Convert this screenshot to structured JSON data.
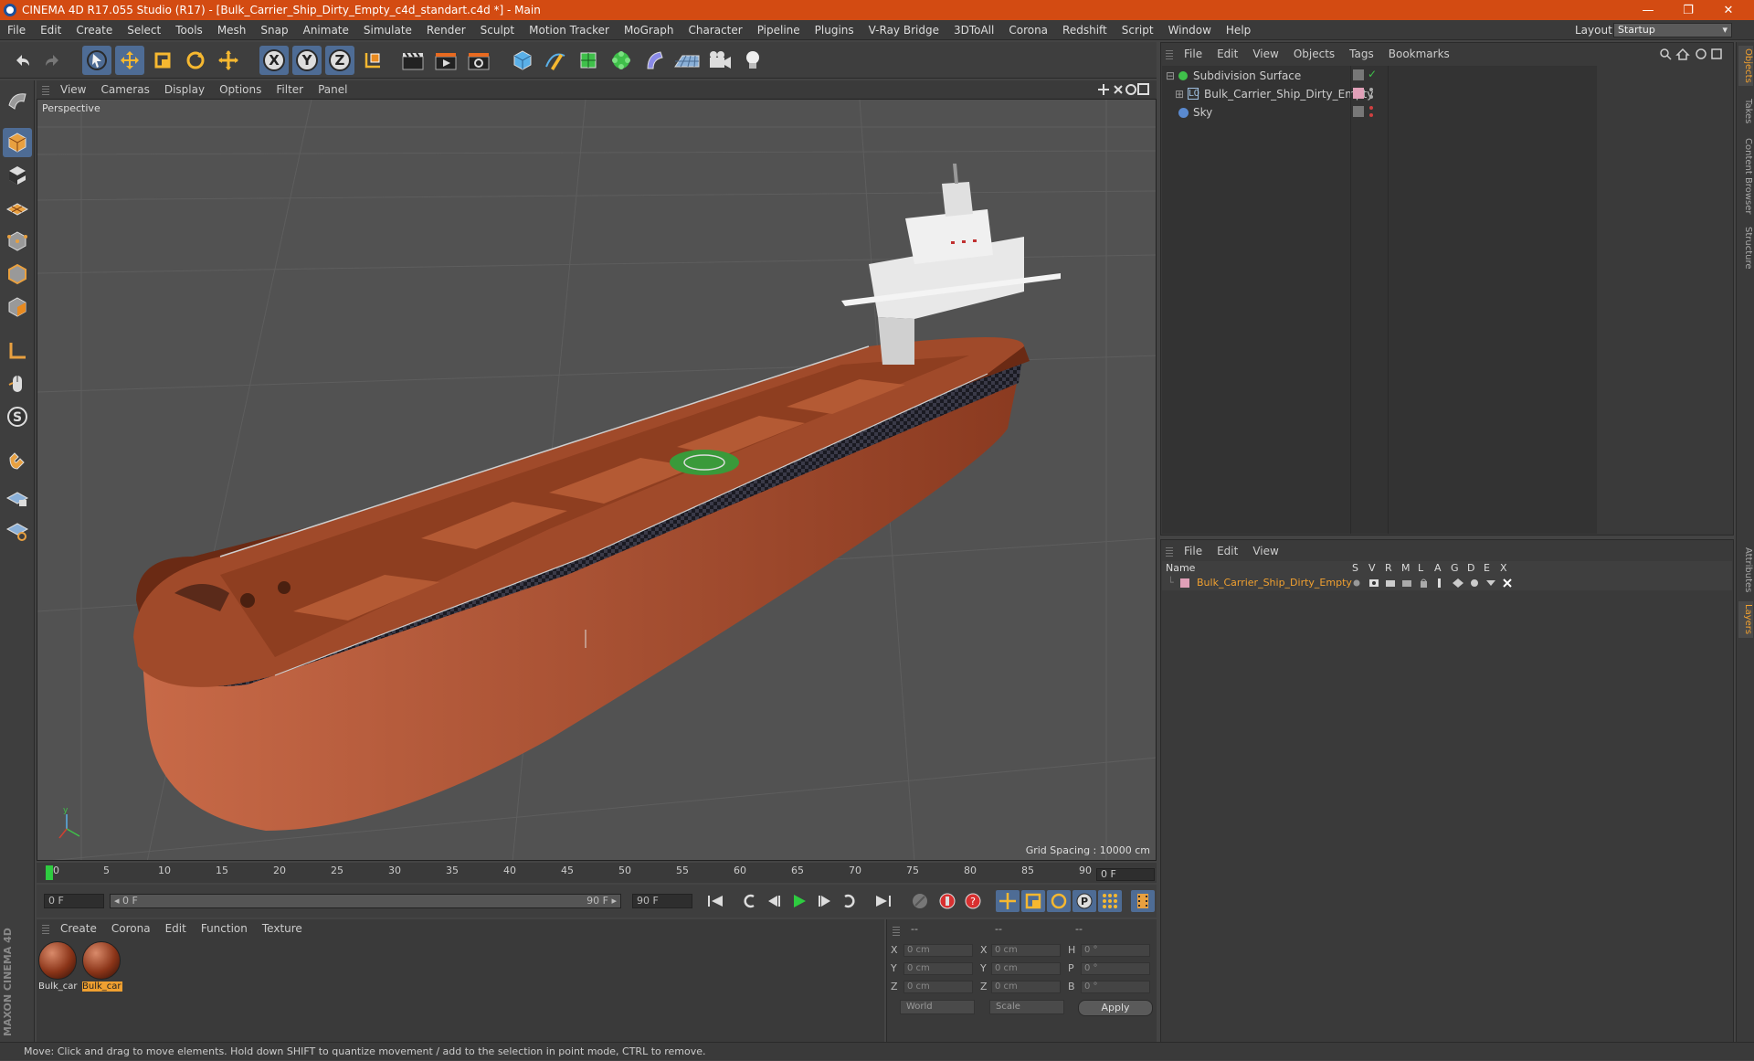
{
  "window": {
    "title": "CINEMA 4D R17.055 Studio (R17) - [Bulk_Carrier_Ship_Dirty_Empty_c4d_standart.c4d *] - Main",
    "minimize": "—",
    "restore": "❐",
    "close": "✕"
  },
  "menu": [
    "File",
    "Edit",
    "Create",
    "Select",
    "Tools",
    "Mesh",
    "Snap",
    "Animate",
    "Simulate",
    "Render",
    "Sculpt",
    "Motion Tracker",
    "MoGraph",
    "Character",
    "Pipeline",
    "Plugins",
    "V-Ray Bridge",
    "3DToAll",
    "Corona",
    "Redshift",
    "Script",
    "Window",
    "Help"
  ],
  "layout": {
    "label": "Layout:",
    "value": "Startup"
  },
  "viewport": {
    "menu": [
      "View",
      "Cameras",
      "Display",
      "Options",
      "Filter",
      "Panel"
    ],
    "camera_label": "Perspective",
    "grid_spacing": "Grid Spacing : 10000 cm"
  },
  "timeline": {
    "ticks": [
      "0",
      "5",
      "10",
      "15",
      "20",
      "25",
      "30",
      "35",
      "40",
      "45",
      "50",
      "55",
      "60",
      "65",
      "70",
      "75",
      "80",
      "85",
      "90"
    ],
    "current_frame": "0 F",
    "start_field": "0 F",
    "range_start": "◂ 0 F",
    "range_end": "90 F ▸",
    "end_field": "90 F"
  },
  "materials": {
    "menu": [
      "Create",
      "Corona",
      "Edit",
      "Function",
      "Texture"
    ],
    "items": [
      {
        "label": "Bulk_car",
        "selected": false
      },
      {
        "label": "Bulk_car",
        "selected": true
      }
    ]
  },
  "coords": {
    "header": [
      "--",
      "--",
      "--"
    ],
    "rows": [
      {
        "a": "X",
        "av": "0 cm",
        "b": "X",
        "bv": "0 cm",
        "c": "H",
        "cv": "0 °"
      },
      {
        "a": "Y",
        "av": "0 cm",
        "b": "Y",
        "bv": "0 cm",
        "c": "P",
        "cv": "0 °"
      },
      {
        "a": "Z",
        "av": "0 cm",
        "b": "Z",
        "bv": "0 cm",
        "c": "B",
        "cv": "0 °"
      }
    ],
    "space": "World",
    "mode": "Scale",
    "apply": "Apply"
  },
  "object_manager": {
    "menu": [
      "File",
      "Edit",
      "View",
      "Objects",
      "Tags",
      "Bookmarks"
    ],
    "objects": [
      {
        "name": "Subdivision Surface",
        "color": "#3fc04a"
      },
      {
        "name": "Bulk_Carrier_Ship_Dirty_Empty",
        "color": "#a0c0e0"
      },
      {
        "name": "Sky",
        "color": "#5a8ad0"
      }
    ]
  },
  "layer_manager": {
    "menu": [
      "File",
      "Edit",
      "View"
    ],
    "columns": [
      "Name",
      "S",
      "V",
      "R",
      "M",
      "L",
      "A",
      "G",
      "D",
      "E",
      "X"
    ],
    "layers": [
      {
        "name": "Bulk_Carrier_Ship_Dirty_Empty",
        "color": "#f0a030"
      }
    ]
  },
  "side_tabs": [
    "Objects",
    "Takes",
    "Content Browser",
    "Structure",
    "Attributes",
    "Layers"
  ],
  "status": "Move: Click and drag to move elements. Hold down SHIFT to quantize movement / add to the selection in point mode, CTRL to remove.",
  "branding": "MAXON CINEMA 4D",
  "colors": {
    "title_bar": "#d34b12",
    "accent": "#f0a030",
    "selected_tool": "#4e6c95"
  }
}
